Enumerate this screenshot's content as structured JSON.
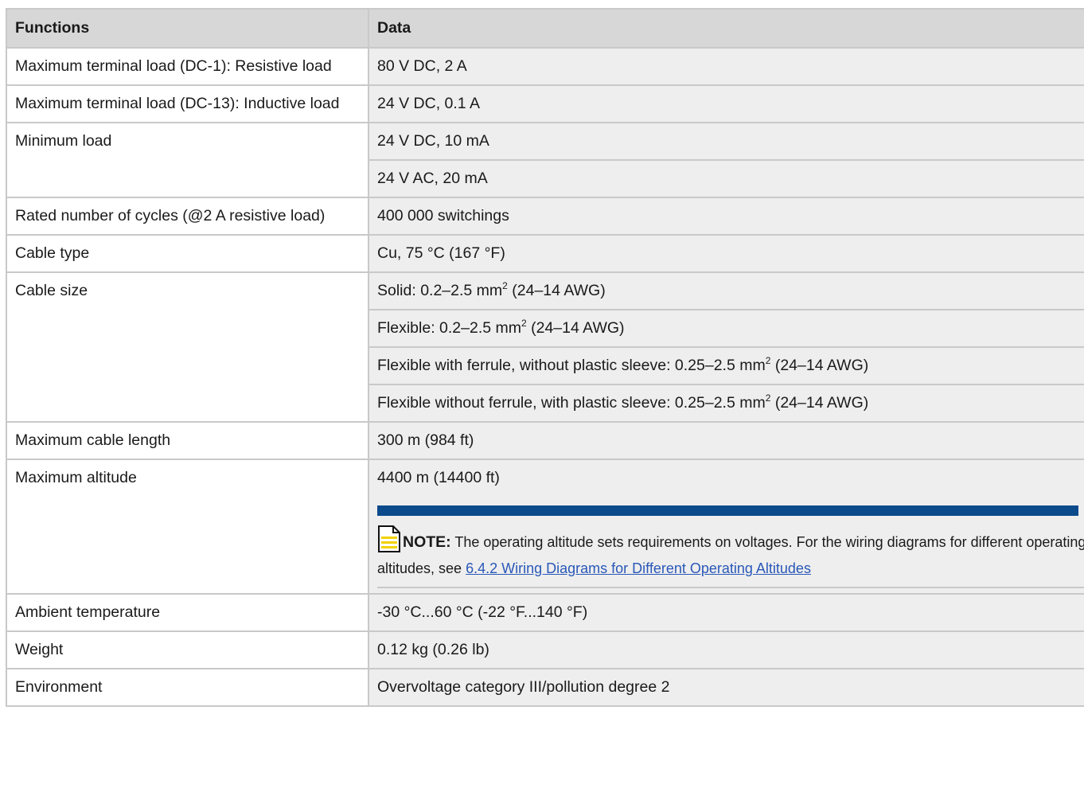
{
  "header": {
    "col1": "Functions",
    "col2": "Data"
  },
  "rows": [
    {
      "function": "Maximum terminal load (DC-1): Resistive load",
      "value": "80 V DC, 2 A"
    },
    {
      "function": "Maximum terminal load (DC-13): Inductive load",
      "value": "24 V DC, 0.1 A"
    },
    {
      "function": "Minimum load",
      "value_1": "24 V DC, 10 mA",
      "value_2": "24 V AC, 20 mA"
    },
    {
      "function": "Rated number of cycles (@2 A resistive load)",
      "value": "400 000 switchings"
    },
    {
      "function": "Cable type",
      "value": "Cu, 75 °C (167 °F)"
    },
    {
      "function": "Cable size",
      "values": [
        {
          "pre": "Solid: 0.2–2.5 mm",
          "sup": "2",
          "post": " (24–14 AWG)"
        },
        {
          "pre": "Flexible: 0.2–2.5 mm",
          "sup": "2",
          "post": " (24–14 AWG)"
        },
        {
          "pre": "Flexible with ferrule, without plastic sleeve: 0.25–2.5 mm",
          "sup": "2",
          "post": " (24–14 AWG)"
        },
        {
          "pre": "Flexible without ferrule, with plastic sleeve: 0.25–2.5 mm",
          "sup": "2",
          "post": " (24–14 AWG)"
        }
      ]
    },
    {
      "function": "Maximum cable length",
      "value": "300 m (984 ft)"
    },
    {
      "function": "Maximum altitude",
      "value": "4400 m (14400 ft)",
      "note": {
        "label": "NOTE:",
        "text": " The operating altitude sets requirements on voltages. For the wiring diagrams for different operating altitudes, see ",
        "link": "6.4.2 Wiring Diagrams for Different Operating Altitudes",
        "icon": "note-document-icon",
        "bar_color": "#0b4a8b",
        "icon_color": "#f2d200"
      }
    },
    {
      "function": "Ambient temperature",
      "value": "-30 °C...60 °C (-22 °F...140 °F)"
    },
    {
      "function": "Weight",
      "value": "0.12 kg (0.26 lb)"
    },
    {
      "function": "Environment",
      "value": "Overvoltage category III/pollution degree 2"
    }
  ],
  "colors": {
    "header_bg": "#d7d7d7",
    "data_bg": "#eeeeee",
    "border": "#c9c9c9",
    "link": "#2a58b8"
  }
}
